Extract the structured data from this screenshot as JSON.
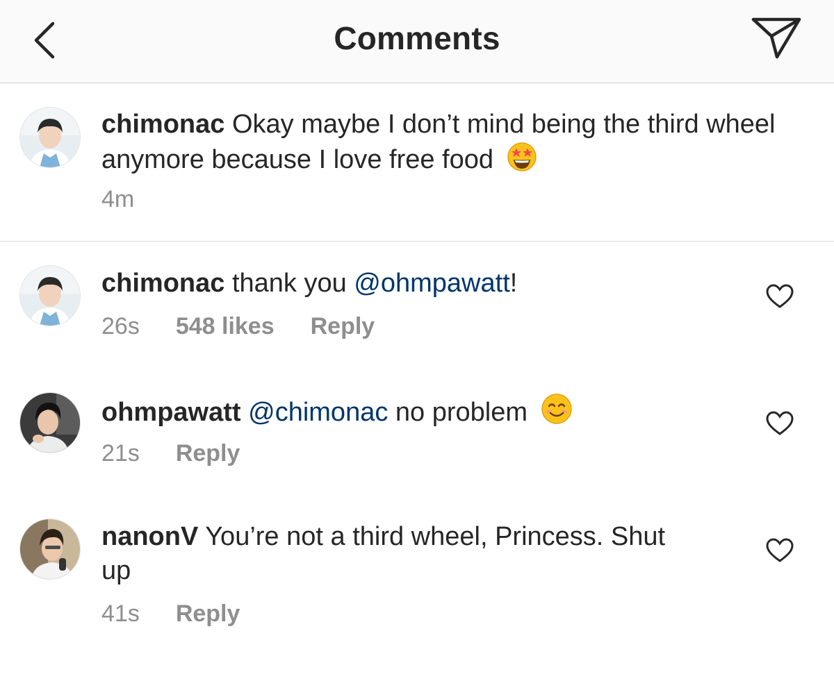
{
  "header": {
    "title": "Comments",
    "back_icon": "chevron-left-icon",
    "share_icon": "paper-plane-icon"
  },
  "caption": {
    "username": "chimonac",
    "text": "Okay maybe I don’t mind being the third wheel anymore because I love free food",
    "emoji": "star-struck-emoji",
    "time": "4m"
  },
  "comments": [
    {
      "username": "chimonac",
      "text_before": "thank you ",
      "mention": "@ohmpawatt",
      "text_after": "!",
      "time": "26s",
      "likes": "548 likes",
      "reply": "Reply"
    },
    {
      "username": "ohmpawatt",
      "mention": "@chimonac",
      "text_after": " no problem",
      "emoji": "smiling-face-emoji",
      "time": "21s",
      "reply": "Reply"
    },
    {
      "username": "nanonV",
      "text": "You’re not a third wheel, Princess. Shut up",
      "time": "41s",
      "reply": "Reply"
    }
  ],
  "colors": {
    "mention": "#003569",
    "meta": "#8e8e8e",
    "text": "#262626",
    "header_bg": "#fafafa"
  }
}
